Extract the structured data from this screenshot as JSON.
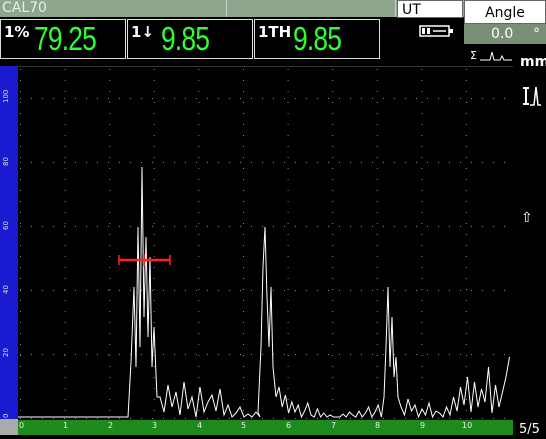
{
  "header": {
    "title": "CAL70",
    "mode": "UT",
    "angle_label": "Angle",
    "angle_value": "0.0",
    "angle_unit": "°"
  },
  "readouts": [
    {
      "label": "1%",
      "value": "79.25"
    },
    {
      "label": "1↓",
      "value": "9.85"
    },
    {
      "label": "1TH",
      "value": "9.85"
    }
  ],
  "graph": {
    "unit": "mm",
    "page": "5/5",
    "y_ticks": [
      "100",
      "80",
      "60",
      "40",
      "20",
      "0"
    ],
    "x_ticks": [
      "0",
      "1",
      "2",
      "3",
      "4",
      "5",
      "6",
      "7",
      "8",
      "9",
      "10"
    ]
  },
  "colors": {
    "readout_value": "#2eff2e",
    "signal": "#ffffff",
    "gate": "#ff2020",
    "y_axis": "#1a1ad0",
    "x_axis": "#1c8a1c"
  },
  "icons": [
    "battery-icon",
    "peak-memory-icon",
    "cursor-up-icon",
    "signal-sigma-icon"
  ]
}
